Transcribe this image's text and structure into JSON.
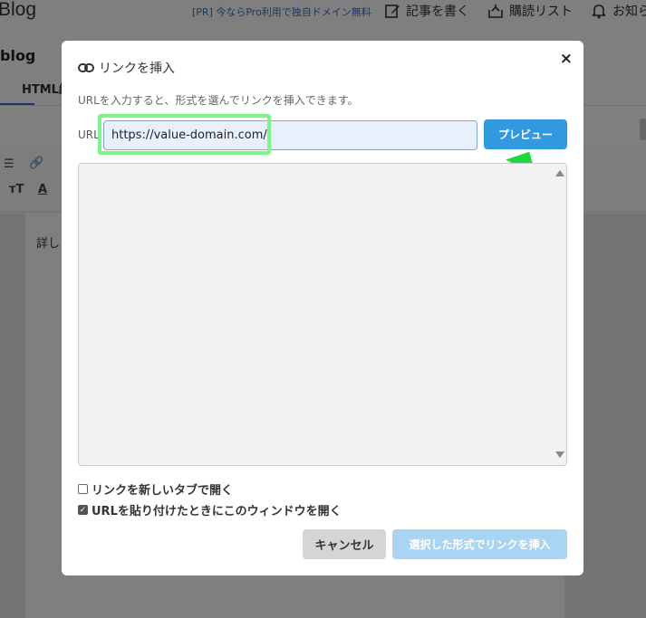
{
  "header": {
    "logo": "Blog",
    "pr_link": "[PR] 今ならPro利用で独自ドメイン無料",
    "write_label": "記事を書く",
    "subscribe_label": "購読リスト",
    "notify_label": "お知ら",
    "write_icon": "pencil-icon",
    "subscribe_icon": "tray-icon",
    "notify_icon": "bell-icon"
  },
  "page": {
    "blog_title": "blog",
    "tab_html": "HTML編",
    "editor_text": "詳し"
  },
  "dialog": {
    "title": "リンクを挿入",
    "title_icon": "link-icon",
    "close_label": "×",
    "description": "URLを入力すると、形式を選んでリンクを挿入できます。",
    "url_label": "URL",
    "url_value": "https://value-domain.com/",
    "preview_button": "プレビュー",
    "options": [
      {
        "label": "リンクを新しいタブで開く",
        "checked": false
      },
      {
        "label": "URLを貼り付けたときにこのウィンドウを開く",
        "checked": true
      }
    ],
    "cancel_button": "キャンセル",
    "insert_button": "選択した形式でリンクを挿入"
  },
  "colors": {
    "primary": "#3199e0",
    "highlight": "#7cf58b",
    "arrow": "#1fd63d",
    "disabled": "#a9d4f2"
  }
}
